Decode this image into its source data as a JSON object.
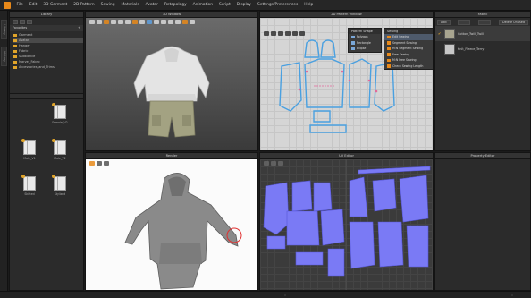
{
  "menubar": {
    "items": [
      "File",
      "Edit",
      "3D Garment",
      "2D Pattern",
      "Sewing",
      "Materials",
      "Avatar",
      "Retopology",
      "Animation",
      "Script",
      "Display",
      "Settings/Preferences",
      "Help"
    ]
  },
  "sidebar": {
    "tabs": [
      "Library",
      "History"
    ]
  },
  "library": {
    "title": "Library",
    "favorites_label": "Favorites",
    "tree": [
      {
        "label": "Garment",
        "selected": false
      },
      {
        "label": "Avatar",
        "selected": true
      },
      {
        "label": "Hanger",
        "selected": false
      },
      {
        "label": "Fabric",
        "selected": false
      },
      {
        "label": "Substance",
        "selected": false
      },
      {
        "label": "Marvel_Fabric",
        "selected": false
      },
      {
        "label": "Accessories_and_Trims",
        "selected": false
      }
    ],
    "items": [
      {
        "label": "Female_V2"
      },
      {
        "label": "Male_V1"
      },
      {
        "label": "Male_V2"
      },
      {
        "label": "Skirted"
      },
      {
        "label": "Stylized"
      }
    ]
  },
  "window3d": {
    "title": "3D Window"
  },
  "pattern_window": {
    "title": "2D Pattern Window",
    "pattern_shape": {
      "title": "Pattern Shape",
      "items": [
        "Polygon",
        "Rectangle",
        "Ellipse"
      ]
    },
    "sewing": {
      "title": "Sewing",
      "items": [
        "Edit Sewing",
        "Segment Sewing",
        "M:N Segment Sewing",
        "Free Sewing",
        "M:N Free Sewing",
        "Check Sewing Length"
      ],
      "active_index": 0
    }
  },
  "render_window": {
    "title": "Render"
  },
  "uv_editor": {
    "title": "UV Editor"
  },
  "fabric_panel": {
    "title": "Fabric",
    "add_label": "Add",
    "delete_unused_label": "Delete Unused",
    "fabrics": [
      {
        "name": "Cotton_Twill_Twill",
        "color": "#a8a590",
        "selected": true
      },
      {
        "name": "Knit_Fleece_Terry",
        "color": "#c7c7c7",
        "selected": false
      }
    ]
  },
  "property_editor": {
    "title": "Property Editor"
  },
  "colors": {
    "accent": "#e8891a",
    "pattern_fill": "#7a7af5",
    "seam": "#4aa0e0"
  }
}
